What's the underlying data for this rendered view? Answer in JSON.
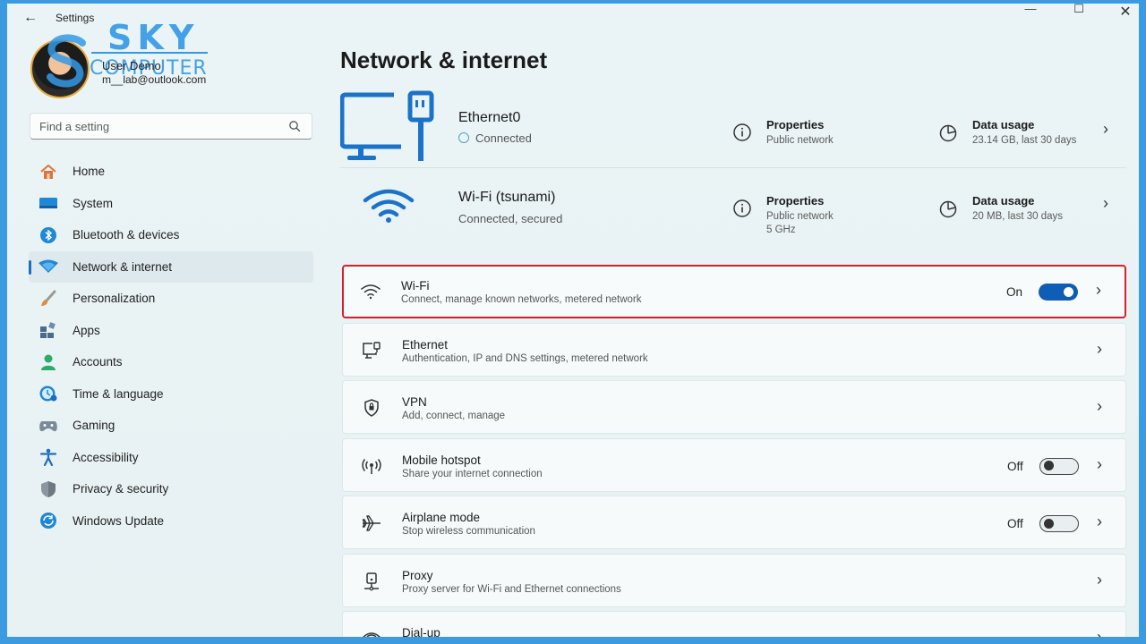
{
  "window": {
    "title": "Settings",
    "back_glyph": "←",
    "minimize_glyph": "—",
    "maximize_glyph": "☐",
    "close_glyph": "✕"
  },
  "watermark": {
    "line1": "SKY",
    "line2": "COMPUTER"
  },
  "user": {
    "name": "User Demo",
    "email": "m__lab@outlook.com"
  },
  "search": {
    "placeholder": "Find a setting",
    "icon": "search-icon"
  },
  "sidebar": {
    "items": [
      {
        "label": "Home",
        "icon": "home-icon",
        "color": "#e0733a"
      },
      {
        "label": "System",
        "icon": "system-icon",
        "color": "#1e88d6"
      },
      {
        "label": "Bluetooth & devices",
        "icon": "bluetooth-icon",
        "color": "#1e88d6"
      },
      {
        "label": "Network & internet",
        "icon": "network-icon",
        "color": "#1e88d6",
        "active": true
      },
      {
        "label": "Personalization",
        "icon": "brush-icon",
        "color": "#e08a3a"
      },
      {
        "label": "Apps",
        "icon": "apps-icon",
        "color": "#4b6b8a"
      },
      {
        "label": "Accounts",
        "icon": "accounts-icon",
        "color": "#2eaa6a"
      },
      {
        "label": "Time & language",
        "icon": "time-language-icon",
        "color": "#1e88d6"
      },
      {
        "label": "Gaming",
        "icon": "gaming-icon",
        "color": "#7a8a99"
      },
      {
        "label": "Accessibility",
        "icon": "accessibility-icon",
        "color": "#1a6fc2"
      },
      {
        "label": "Privacy & security",
        "icon": "shield-icon",
        "color": "#8a96a0"
      },
      {
        "label": "Windows Update",
        "icon": "update-icon",
        "color": "#1e88d6"
      }
    ]
  },
  "main": {
    "title": "Network & internet",
    "connections": [
      {
        "name": "Ethernet0",
        "status": "Connected",
        "icon": "ethernet-monitor-icon",
        "properties": {
          "title": "Properties",
          "sub": "Public network"
        },
        "usage": {
          "title": "Data usage",
          "sub": "23.14 GB, last 30 days"
        }
      },
      {
        "name": "Wi-Fi (tsunami)",
        "status": "Connected, secured",
        "icon": "wifi-large-icon",
        "properties": {
          "title": "Properties",
          "sub": "Public network",
          "sub2": "5 GHz"
        },
        "usage": {
          "title": "Data usage",
          "sub": "20 MB, last 30 days"
        }
      }
    ],
    "settings": [
      {
        "title": "Wi-Fi",
        "desc": "Connect, manage known networks, metered network",
        "icon": "wifi-icon",
        "state": "On",
        "toggle": "on",
        "highlight": true
      },
      {
        "title": "Ethernet",
        "desc": "Authentication, IP and DNS settings, metered network",
        "icon": "ethernet-icon"
      },
      {
        "title": "VPN",
        "desc": "Add, connect, manage",
        "icon": "vpn-shield-icon"
      },
      {
        "title": "Mobile hotspot",
        "desc": "Share your internet connection",
        "icon": "hotspot-icon",
        "state": "Off",
        "toggle": "off"
      },
      {
        "title": "Airplane mode",
        "desc": "Stop wireless communication",
        "icon": "airplane-icon",
        "state": "Off",
        "toggle": "off"
      },
      {
        "title": "Proxy",
        "desc": "Proxy server for Wi-Fi and Ethernet connections",
        "icon": "proxy-icon"
      },
      {
        "title": "Dial-up",
        "desc": "",
        "icon": "dialup-icon"
      }
    ],
    "chevron": "›"
  }
}
